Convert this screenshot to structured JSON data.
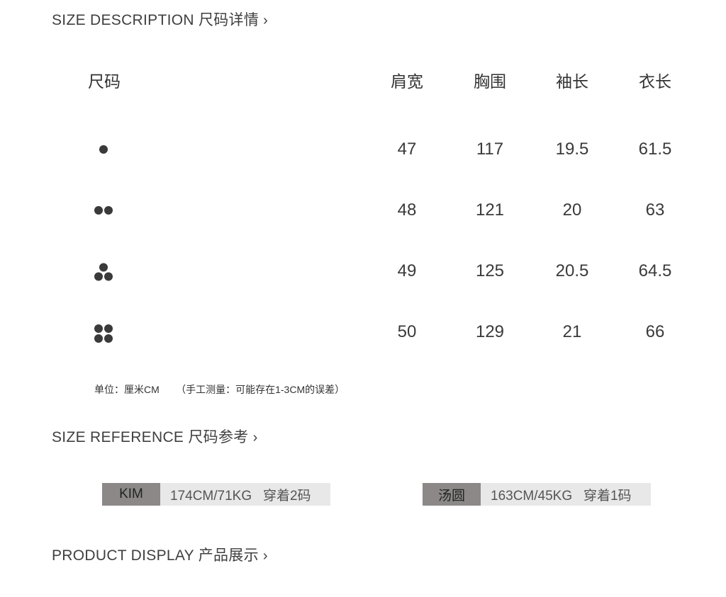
{
  "sections": {
    "description": "SIZE DESCRIPTION 尺码详情",
    "reference": "SIZE REFERENCE 尺码参考",
    "display": "PRODUCT DISPLAY 产品展示",
    "chevron": "›"
  },
  "table": {
    "headers": [
      "尺码",
      "肩宽",
      "胸围",
      "袖长",
      "衣长"
    ],
    "rows": [
      {
        "size_icon": "one-dot-icon",
        "values": [
          "47",
          "117",
          "19.5",
          "61.5"
        ]
      },
      {
        "size_icon": "two-dots-icon",
        "values": [
          "48",
          "121",
          "20",
          "63"
        ]
      },
      {
        "size_icon": "three-dots-icon",
        "values": [
          "49",
          "125",
          "20.5",
          "64.5"
        ]
      },
      {
        "size_icon": "four-dots-icon",
        "values": [
          "50",
          "129",
          "21",
          "66"
        ]
      }
    ]
  },
  "note": "单位：厘米CM      （手工测量：可能存在1-3CM的误差）",
  "references": [
    {
      "name": "KIM",
      "info": "174CM/71KG   穿着2码"
    },
    {
      "name": "汤圆",
      "info": "163CM/45KG   穿着1码"
    }
  ],
  "colors": {
    "badge_name_bg": "#8c8888",
    "badge_info_bg": "#e8e8e8",
    "text": "#3a3a3a"
  }
}
